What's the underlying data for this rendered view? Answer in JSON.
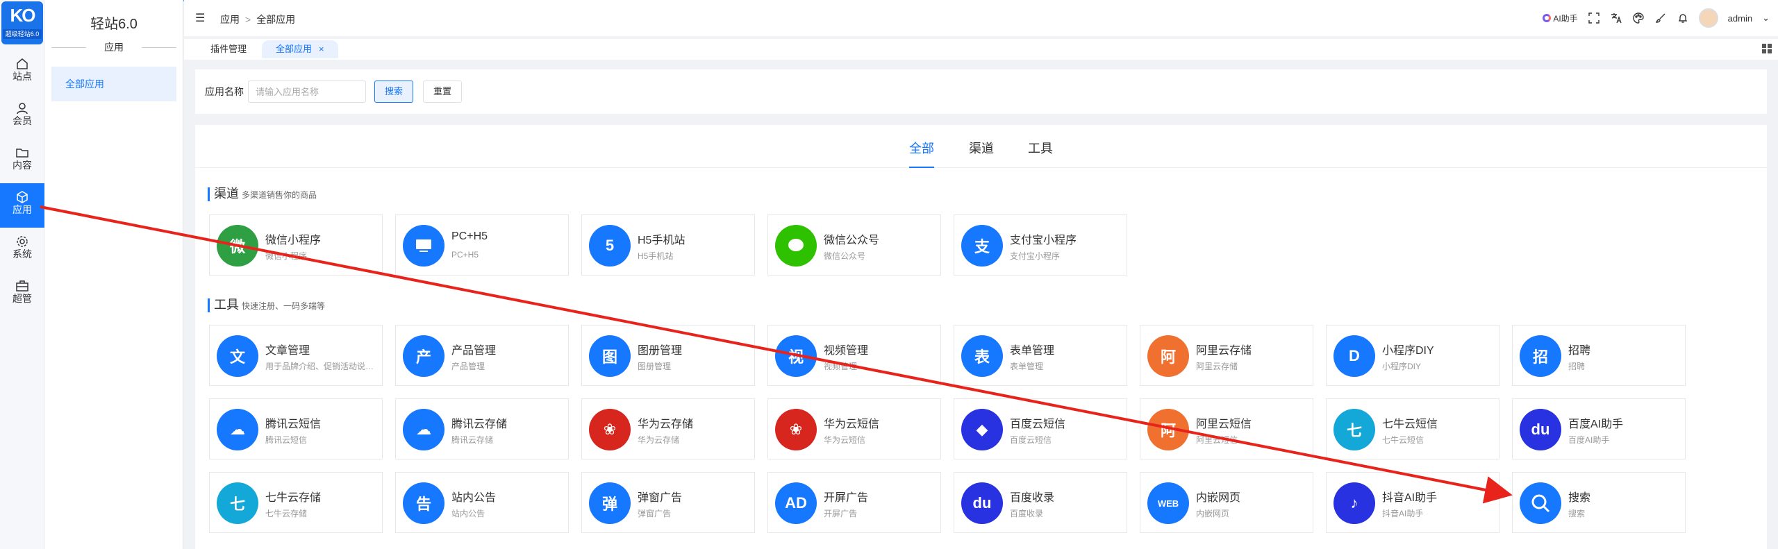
{
  "logo": {
    "mark": "KO",
    "sub": "超级轻站6.0"
  },
  "left_nav": [
    {
      "label": "站点",
      "icon": "home-icon"
    },
    {
      "label": "会员",
      "icon": "user-icon"
    },
    {
      "label": "内容",
      "icon": "folder-icon"
    },
    {
      "label": "应用",
      "icon": "cube-icon",
      "active": true
    },
    {
      "label": "系统",
      "icon": "gear-icon"
    },
    {
      "label": "超管",
      "icon": "briefcase-icon"
    }
  ],
  "sidebar": {
    "title": "轻站6.0",
    "section": "应用",
    "item": "全部应用"
  },
  "header": {
    "crumb_root": "应用",
    "crumb_sep": ">",
    "crumb_current": "全部应用",
    "ai_label": "AI助手",
    "user": "admin"
  },
  "tabs": [
    {
      "label": "插件管理"
    },
    {
      "label": "全部应用",
      "close": "×"
    }
  ],
  "search": {
    "label": "应用名称",
    "placeholder": "请输入应用名称",
    "search_btn": "搜索",
    "reset_btn": "重置"
  },
  "category_tabs": [
    "全部",
    "渠道",
    "工具"
  ],
  "sections": {
    "channel": {
      "title": "渠道",
      "desc": "多渠道销售你的商品"
    },
    "tools": {
      "title": "工具",
      "desc": "快速注册、一码多端等"
    }
  },
  "channel_apps": [
    {
      "name": "微信小程序",
      "desc": "微信小程序",
      "color": "#2ea043",
      "icon": "wechat-miniprogram-icon",
      "glyph": "微"
    },
    {
      "name": "PC+H5",
      "desc": "PC+H5",
      "color": "#1677ff",
      "icon": "monitor-icon",
      "glyph": ""
    },
    {
      "name": "H5手机站",
      "desc": "H5手机站",
      "color": "#1677ff",
      "icon": "html5-icon",
      "glyph": "5"
    },
    {
      "name": "微信公众号",
      "desc": "微信公众号",
      "color": "#2dc100",
      "icon": "wechat-icon",
      "glyph": ""
    },
    {
      "name": "支付宝小程序",
      "desc": "支付宝小程序",
      "color": "#1677ff",
      "icon": "alipay-icon",
      "glyph": "支"
    }
  ],
  "tool_apps": [
    {
      "name": "文章管理",
      "desc": "用于品牌介绍、促销活动说明等",
      "color": "#1677ff",
      "icon": "article-icon",
      "glyph": "文"
    },
    {
      "name": "产品管理",
      "desc": "产品管理",
      "color": "#1677ff",
      "icon": "product-icon",
      "glyph": "产"
    },
    {
      "name": "图册管理",
      "desc": "图册管理",
      "color": "#1677ff",
      "icon": "album-icon",
      "glyph": "图"
    },
    {
      "name": "视频管理",
      "desc": "视频管理",
      "color": "#1677ff",
      "icon": "video-icon",
      "glyph": "视"
    },
    {
      "name": "表单管理",
      "desc": "表单管理",
      "color": "#1677ff",
      "icon": "form-icon",
      "glyph": "表"
    },
    {
      "name": "阿里云存储",
      "desc": "阿里云存储",
      "color": "#f07030",
      "icon": "aliyun-oss-icon",
      "glyph": "阿"
    },
    {
      "name": "小程序DIY",
      "desc": "小程序DIY",
      "color": "#1677ff",
      "icon": "diy-icon",
      "glyph": "D"
    },
    {
      "name": "招聘",
      "desc": "招聘",
      "color": "#1677ff",
      "icon": "recruit-icon",
      "glyph": "招"
    },
    {
      "name": "腾讯云短信",
      "desc": "腾讯云短信",
      "color": "#1677ff",
      "icon": "tencent-cloud-icon",
      "glyph": "☁"
    },
    {
      "name": "腾讯云存储",
      "desc": "腾讯云存储",
      "color": "#1677ff",
      "icon": "tencent-cloud-icon",
      "glyph": "☁"
    },
    {
      "name": "华为云存储",
      "desc": "华为云存储",
      "color": "#d7261e",
      "icon": "huawei-icon",
      "glyph": "❀"
    },
    {
      "name": "华为云短信",
      "desc": "华为云短信",
      "color": "#d7261e",
      "icon": "huawei-icon",
      "glyph": "❀"
    },
    {
      "name": "百度云短信",
      "desc": "百度云短信",
      "color": "#2932e1",
      "icon": "baidu-cloud-icon",
      "glyph": "◆"
    },
    {
      "name": "阿里云短信",
      "desc": "阿里云短信",
      "color": "#f07030",
      "icon": "aliyun-sms-icon",
      "glyph": "阿"
    },
    {
      "name": "七牛云短信",
      "desc": "七牛云短信",
      "color": "#13a8d8",
      "icon": "qiniu-icon",
      "glyph": "七"
    },
    {
      "name": "百度AI助手",
      "desc": "百度AI助手",
      "color": "#2932e1",
      "icon": "baidu-icon",
      "glyph": "du"
    },
    {
      "name": "七牛云存储",
      "desc": "七牛云存储",
      "color": "#13a8d8",
      "icon": "qiniu-icon",
      "glyph": "七"
    },
    {
      "name": "站内公告",
      "desc": "站内公告",
      "color": "#1677ff",
      "icon": "notice-icon",
      "glyph": "告"
    },
    {
      "name": "弹窗广告",
      "desc": "弹窗广告",
      "color": "#1677ff",
      "icon": "popup-ad-icon",
      "glyph": "弹"
    },
    {
      "name": "开屏广告",
      "desc": "开屏广告",
      "color": "#1677ff",
      "icon": "splash-ad-icon",
      "glyph": "AD"
    },
    {
      "name": "百度收录",
      "desc": "百度收录",
      "color": "#2932e1",
      "icon": "baidu-icon",
      "glyph": "du"
    },
    {
      "name": "内嵌网页",
      "desc": "内嵌网页",
      "color": "#1677ff",
      "icon": "web-icon",
      "glyph": "WEB"
    },
    {
      "name": "抖音AI助手",
      "desc": "抖音AI助手",
      "color": "#2932e1",
      "icon": "douyin-icon",
      "glyph": "♪"
    },
    {
      "name": "搜索",
      "desc": "搜索",
      "color": "#1677ff",
      "icon": "search-icon",
      "glyph": ""
    }
  ],
  "colors": {
    "accent": "#1677ff",
    "arrow": "#e8231c"
  }
}
